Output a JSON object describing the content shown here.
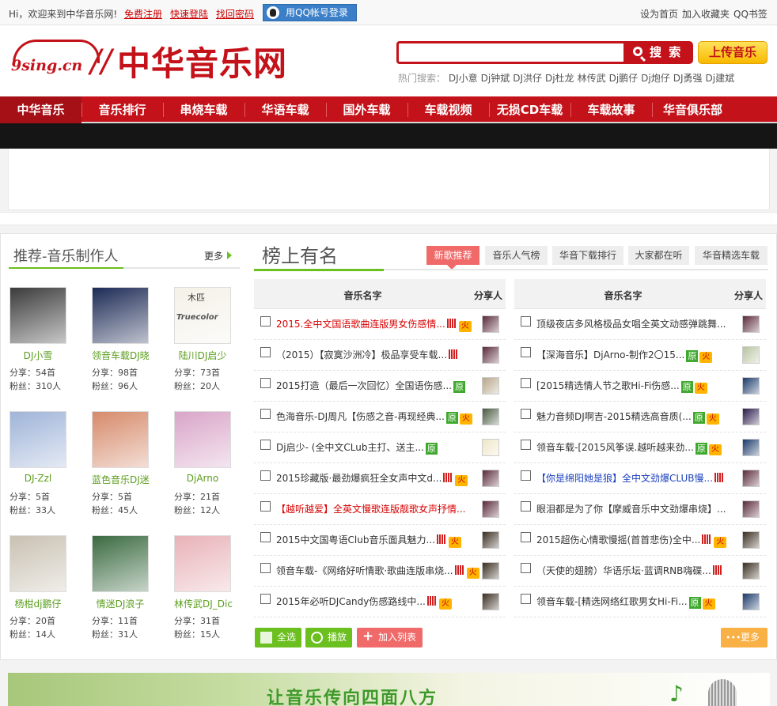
{
  "topbar": {
    "welcome": "Hi，欢迎来到中华音乐网!",
    "register": "免费注册",
    "login": "快速登陆",
    "recover": "找回密码",
    "qq_login": "用QQ帐号登录",
    "links": [
      "设为首页",
      "加入收藏夹",
      "QQ书签"
    ]
  },
  "header": {
    "logo_domain": "9sing.cn",
    "logo_name": "中华音乐网",
    "search_placeholder": "",
    "search_button": "搜 索",
    "upload_button": "上传音乐",
    "hot_label": "热门搜索：",
    "hot_keywords": [
      "DJ小意",
      "Dj钟斌",
      "DJ洪仔",
      "Dj杜龙",
      "林传武",
      "Dj鹏仔",
      "Dj炮仔",
      "DJ勇强",
      "Dj建斌"
    ]
  },
  "nav": {
    "items": [
      "中华音乐",
      "音乐排行",
      "串烧车载",
      "华语车载",
      "国外车载",
      "车载视频",
      "无损CD车载",
      "车载故事",
      "华音俱乐部"
    ],
    "active_index": 0
  },
  "producers": {
    "title": "推荐-音乐制作人",
    "more": "更多",
    "share_label": "分享：",
    "fans_label": "粉丝：",
    "items": [
      {
        "name": "DJ小雪",
        "shares": "54首",
        "fans": "310人",
        "avatar_color": "#3b3b3b"
      },
      {
        "name": "领音车载DJ晓",
        "shares": "98首",
        "fans": "96人",
        "avatar_color": "#1c2a55"
      },
      {
        "name": "陆川DJ启少",
        "shares": "73首",
        "fans": "20人",
        "avatar_color": "#f4f1e8",
        "avatar_text": "木匹",
        "avatar_text2": "Truecolor"
      },
      {
        "name": "DJ-Zzl",
        "shares": "5首",
        "fans": "33人",
        "avatar_color": "#9fb4d8"
      },
      {
        "name": "蓝色音乐DJ迷",
        "shares": "5首",
        "fans": "45人",
        "avatar_color": "#d68a6a"
      },
      {
        "name": "DjArno",
        "shares": "21首",
        "fans": "12人",
        "avatar_color": "#d9a5c8"
      },
      {
        "name": "杨柑dj鹏仔",
        "shares": "20首",
        "fans": "14人",
        "avatar_color": "#c9c1b2"
      },
      {
        "name": "情迷DJ浪子",
        "shares": "11首",
        "fans": "31人",
        "avatar_color": "#3a6a40"
      },
      {
        "name": "林传武DJ_Dic",
        "shares": "31首",
        "fans": "15人",
        "avatar_color": "#e8b2b8"
      }
    ]
  },
  "ranking": {
    "title": "榜上有名",
    "tabs": [
      "新歌推荐",
      "音乐人气榜",
      "华音下载排行",
      "大家都在听",
      "华音精选车载"
    ],
    "active_tab": 0,
    "col_name": "音乐名字",
    "col_sharer": "分享人",
    "fire_label": "火",
    "orig_label": "原",
    "left_rows": [
      {
        "title": "2015.全中文国语歌曲连版男女伤感情...",
        "red": true,
        "bars": true,
        "fire": true,
        "orig": false,
        "thumb": "#5a2a3a"
      },
      {
        "title": "（2015）【寂寞沙洲冷】极品享受车载...",
        "red": false,
        "bars": true,
        "fire": false,
        "orig": false,
        "thumb": "#5a2a3a"
      },
      {
        "title": "2015打造（最后一次回忆）全国语伤感...",
        "red": false,
        "bars": false,
        "fire": false,
        "orig": true,
        "thumb": "#b7a68a"
      },
      {
        "title": "色海音乐-DJ周凡【伤感之音-再现经典...",
        "red": false,
        "bars": false,
        "fire": true,
        "orig": true,
        "thumb": "#4a5a40"
      },
      {
        "title": "Dj启少- (全中文CLub主打、送主...",
        "red": false,
        "bars": false,
        "fire": false,
        "orig": true,
        "thumb": "#efe6c8"
      },
      {
        "title": "2015珍藏版·最劲爆疯狂全女声中文d...",
        "red": false,
        "bars": true,
        "fire": true,
        "orig": false,
        "thumb": "#5a2a3a"
      },
      {
        "title": "【越听越爱】全英文慢歌连版靓歌女声抒情...",
        "red": true,
        "bars": false,
        "fire": false,
        "orig": false,
        "thumb": "#5a2a3a"
      },
      {
        "title": "2015中文国粤语Club音乐面具魅力...",
        "red": false,
        "bars": true,
        "fire": true,
        "orig": false,
        "thumb": "#3a2e20"
      },
      {
        "title": "领音车载-《网络好听情歌·歌曲连版串烧...",
        "red": false,
        "bars": true,
        "fire": true,
        "orig": false,
        "thumb": "#3a2e20"
      },
      {
        "title": "2015年必听DJCandy伤感路线中...",
        "red": false,
        "bars": true,
        "fire": true,
        "orig": false,
        "thumb": "#3a2e20"
      }
    ],
    "right_rows": [
      {
        "title": "顶级夜店多风格极品女唱全英文动感弹跳舞...",
        "red": false,
        "bars": false,
        "fire": false,
        "orig": false,
        "thumb": "#5a2a3a"
      },
      {
        "title": "【深海音乐】DjArno-制作2〇15...",
        "red": false,
        "bars": false,
        "fire": true,
        "orig": true,
        "thumb": "#b8c4a0"
      },
      {
        "title": "[2015精选情人节之歌Hi-Fi伤感...",
        "red": false,
        "bars": false,
        "fire": true,
        "orig": true,
        "thumb": "#1a3a6a"
      },
      {
        "title": "魅力音频DJ啊吉-2015精选高音质(...",
        "red": false,
        "bars": false,
        "fire": true,
        "orig": true,
        "thumb": "#2a1a4a"
      },
      {
        "title": "领音车载-[2015风筝误.越听越来劲...",
        "red": false,
        "bars": false,
        "fire": true,
        "orig": true,
        "thumb": "#1a3a6a"
      },
      {
        "title": "【你是绵阳她是狼】全中文劲爆CLUB慢...",
        "red": true,
        "bars": true,
        "fire": false,
        "orig": false,
        "thumb": "#5a2a3a",
        "blue": true
      },
      {
        "title": "眼泪都是为了你【摩威音乐中文劲爆串烧】...",
        "red": false,
        "bars": false,
        "fire": false,
        "orig": false,
        "thumb": "#5a2a3a"
      },
      {
        "title": "2015超伤心情歌慢摇(首首悲伤)全中...",
        "red": false,
        "bars": true,
        "fire": true,
        "orig": false,
        "thumb": "#3a2e20"
      },
      {
        "title": "（天使的翅膀）华语乐坛·蓝调RNB嗨碟...",
        "red": false,
        "bars": true,
        "fire": false,
        "orig": false,
        "thumb": "#3a2e20"
      },
      {
        "title": "领音车载-[精选网络红歌男女Hi-Fi...",
        "red": false,
        "bars": false,
        "fire": true,
        "orig": true,
        "thumb": "#1a3a6a"
      }
    ],
    "buttons": {
      "select_all": "全选",
      "play": "播放",
      "add_list": "加入列表",
      "more": "更多"
    }
  },
  "bottom_banner": {
    "slogan": "让音乐传向四面八方"
  },
  "colors": {
    "brand_red": "#c4121a",
    "accent_green": "#6bbf1f",
    "tab_active": "#f06a6a"
  }
}
